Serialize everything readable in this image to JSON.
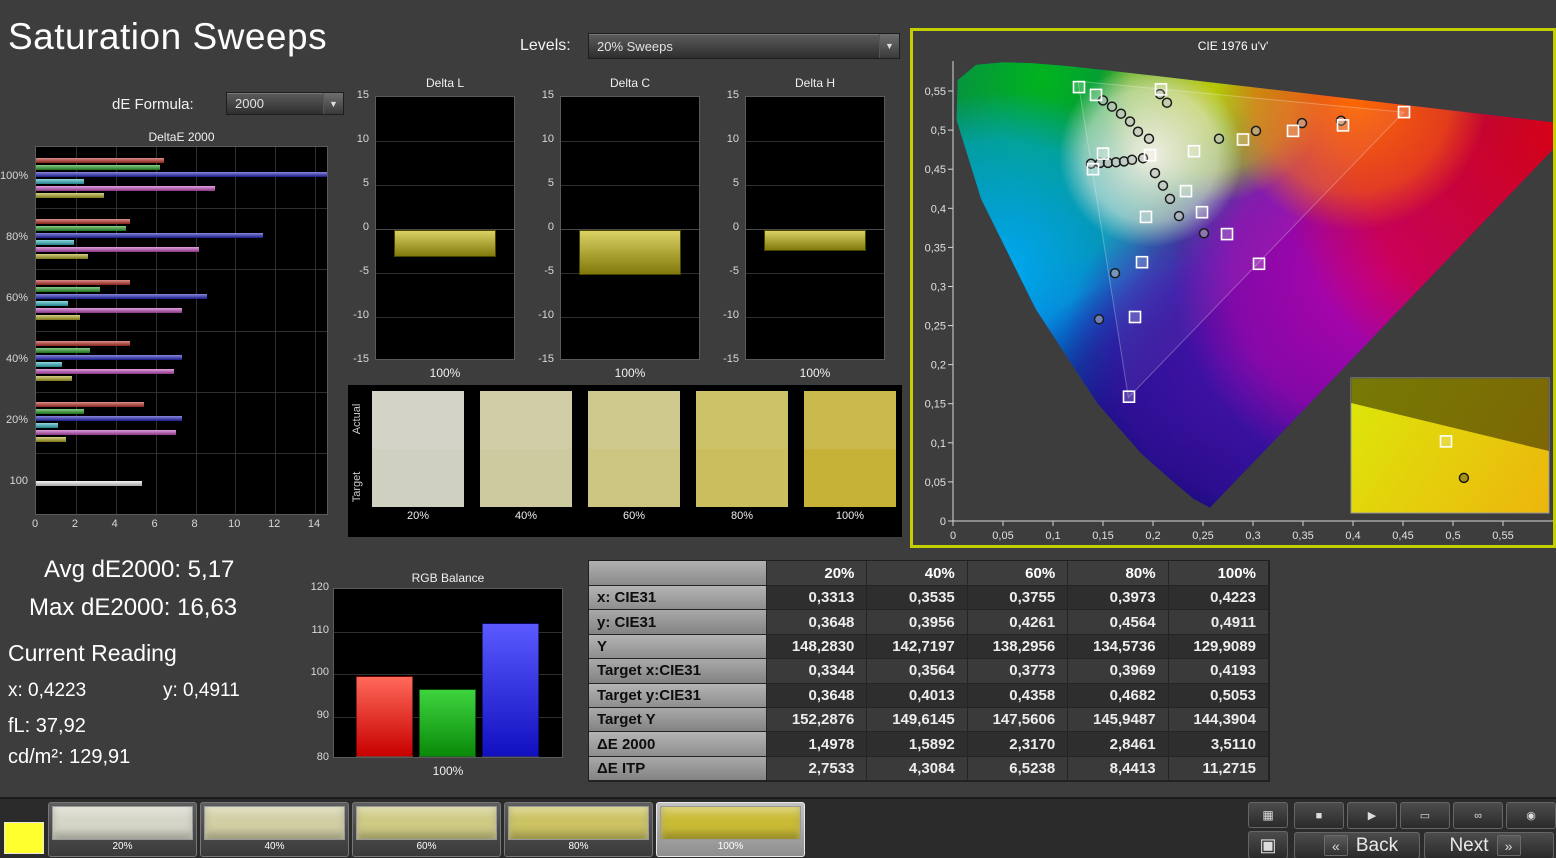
{
  "title": "Saturation Sweeps",
  "controls": {
    "de_formula_label": "dE Formula:",
    "de_formula_value": "2000",
    "levels_label": "Levels:",
    "levels_value": "20% Sweeps"
  },
  "deltae_chart": {
    "title": "DeltaE 2000",
    "x_ticks": [
      0,
      2,
      4,
      6,
      8,
      10,
      12,
      14
    ],
    "x_max": 14.6,
    "bar_colors": [
      "#c03228",
      "#2aa22a",
      "#2626c0",
      "#35b9c5",
      "#c44fc0",
      "#b2aa22",
      "#ececec"
    ],
    "groups": [
      {
        "label": "100%",
        "values": [
          6.4,
          6.2,
          14.6,
          2.4,
          9.0,
          3.4
        ]
      },
      {
        "label": "80%",
        "values": [
          4.7,
          4.5,
          11.4,
          1.9,
          8.2,
          2.6
        ]
      },
      {
        "label": "60%",
        "values": [
          4.7,
          3.2,
          8.6,
          1.6,
          7.3,
          2.2
        ]
      },
      {
        "label": "40%",
        "values": [
          4.7,
          2.7,
          7.3,
          1.3,
          6.9,
          1.8
        ]
      },
      {
        "label": "20%",
        "values": [
          5.4,
          2.4,
          7.3,
          1.1,
          7.0,
          1.5
        ]
      },
      {
        "label": "100",
        "values": [
          5.3
        ]
      }
    ]
  },
  "delta_axis": {
    "min": -15,
    "max": 15,
    "ticks": [
      "15",
      "10",
      "5",
      "0",
      "-5",
      "-10",
      "-15"
    ]
  },
  "delta_charts": [
    {
      "title": "Delta L",
      "value": -3.1,
      "x_label": "100%"
    },
    {
      "title": "Delta C",
      "value": -5.1,
      "x_label": "100%"
    },
    {
      "title": "Delta H",
      "value": -2.4,
      "x_label": "100%"
    }
  ],
  "swatch_strip": {
    "row_labels": [
      "Actual",
      "Target"
    ],
    "columns": [
      {
        "label": "20%",
        "actual": "#d3d3c7",
        "target": "#d0d0c1"
      },
      {
        "label": "40%",
        "actual": "#d1cea7",
        "target": "#cecaa0"
      },
      {
        "label": "60%",
        "actual": "#cec98d",
        "target": "#ccc682"
      },
      {
        "label": "80%",
        "actual": "#ccc268",
        "target": "#cabe5e"
      },
      {
        "label": "100%",
        "actual": "#cab94d",
        "target": "#c6b236"
      }
    ]
  },
  "cie": {
    "title": "CIE 1976 u'v'",
    "tick_step": 0.05,
    "x_tick_labels": [
      "0",
      "0,05",
      "0,1",
      "0,15",
      "0,2",
      "0,25",
      "0,3",
      "0,35",
      "0,4",
      "0,45",
      "0,5",
      "0,55"
    ],
    "y_tick_labels": [
      "0",
      "0,05",
      "0,1",
      "0,15",
      "0,2",
      "0,25",
      "0,3",
      "0,35",
      "0,4",
      "0,45",
      "0,5",
      "0,55"
    ],
    "squares": [
      [
        0.126,
        0.555
      ],
      [
        0.143,
        0.545
      ],
      [
        0.208,
        0.552
      ],
      [
        0.15,
        0.47
      ],
      [
        0.14,
        0.45
      ],
      [
        0.197,
        0.468
      ],
      [
        0.241,
        0.473
      ],
      [
        0.29,
        0.488
      ],
      [
        0.34,
        0.499
      ],
      [
        0.39,
        0.506
      ],
      [
        0.451,
        0.523
      ],
      [
        0.233,
        0.422
      ],
      [
        0.249,
        0.395
      ],
      [
        0.274,
        0.367
      ],
      [
        0.306,
        0.329
      ],
      [
        0.193,
        0.389
      ],
      [
        0.189,
        0.331
      ],
      [
        0.182,
        0.261
      ],
      [
        0.176,
        0.159
      ]
    ],
    "circles": [
      [
        0.15,
        0.538
      ],
      [
        0.159,
        0.53
      ],
      [
        0.168,
        0.521
      ],
      [
        0.177,
        0.511
      ],
      [
        0.185,
        0.498
      ],
      [
        0.207,
        0.546
      ],
      [
        0.214,
        0.535
      ],
      [
        0.138,
        0.457
      ],
      [
        0.147,
        0.458
      ],
      [
        0.155,
        0.458
      ],
      [
        0.163,
        0.459
      ],
      [
        0.171,
        0.46
      ],
      [
        0.179,
        0.462
      ],
      [
        0.19,
        0.464
      ],
      [
        0.196,
        0.489
      ],
      [
        0.266,
        0.489
      ],
      [
        0.303,
        0.499
      ],
      [
        0.349,
        0.509
      ],
      [
        0.388,
        0.512
      ],
      [
        0.202,
        0.445
      ],
      [
        0.21,
        0.429
      ],
      [
        0.217,
        0.412
      ],
      [
        0.226,
        0.39
      ],
      [
        0.251,
        0.368
      ],
      [
        0.162,
        0.317
      ],
      [
        0.146,
        0.258
      ]
    ],
    "inset": {
      "square": [
        0.48,
        0.47
      ],
      "circle": [
        0.57,
        0.74
      ]
    }
  },
  "readings": {
    "avg": "Avg dE2000: 5,17",
    "max": "Max dE2000: 16,63",
    "current_label": "Current Reading",
    "x": "x: 0,4223",
    "y": "y: 0,4911",
    "fl": "fL: 37,92",
    "cdm2": "cd/m²: 129,91"
  },
  "rgb_balance": {
    "title": "RGB Balance",
    "axis": {
      "min": 80,
      "max": 120,
      "ticks": [
        "120",
        "110",
        "100",
        "90",
        "80"
      ]
    },
    "values": {
      "red": 99,
      "green": 96,
      "blue": 111.5
    },
    "x_label": "100%"
  },
  "table": {
    "headers": [
      "",
      "20%",
      "40%",
      "60%",
      "80%",
      "100%"
    ],
    "rows": [
      {
        "label": "x: CIE31",
        "values": [
          "0,3313",
          "0,3535",
          "0,3755",
          "0,3973",
          "0,4223"
        ]
      },
      {
        "label": "y: CIE31",
        "values": [
          "0,3648",
          "0,3956",
          "0,4261",
          "0,4564",
          "0,4911"
        ]
      },
      {
        "label": "Y",
        "values": [
          "148,2830",
          "142,7197",
          "138,2956",
          "134,5736",
          "129,9089"
        ]
      },
      {
        "label": "Target x:CIE31",
        "values": [
          "0,3344",
          "0,3564",
          "0,3773",
          "0,3969",
          "0,4193"
        ]
      },
      {
        "label": "Target y:CIE31",
        "values": [
          "0,3648",
          "0,4013",
          "0,4358",
          "0,4682",
          "0,5053"
        ]
      },
      {
        "label": "Target Y",
        "values": [
          "152,2876",
          "149,6145",
          "147,5606",
          "145,9487",
          "144,3904"
        ]
      },
      {
        "label": "ΔE 2000",
        "values": [
          "1,4978",
          "1,5892",
          "2,3170",
          "2,8461",
          "3,5110"
        ]
      },
      {
        "label": "ΔE ITP",
        "values": [
          "2,7533",
          "4,3084",
          "6,5238",
          "8,4413",
          "11,2715"
        ]
      }
    ]
  },
  "bottom_bar": {
    "current_color": "#ffff2e",
    "swatches": [
      {
        "label": "20%",
        "color": "#d6d6c8"
      },
      {
        "label": "40%",
        "color": "#d2cfa5"
      },
      {
        "label": "60%",
        "color": "#cfcb85"
      },
      {
        "label": "80%",
        "color": "#ccc363"
      },
      {
        "label": "100%",
        "color": "#cabb35"
      }
    ],
    "selected_index": 4,
    "transport_stack": [
      {
        "name": "pattern-grid-button",
        "glyph": "▦"
      },
      {
        "name": "pattern-window-button",
        "glyph": "▣"
      }
    ],
    "transport_buttons": [
      {
        "name": "stop-button",
        "glyph": "■"
      },
      {
        "name": "play-button",
        "glyph": "▶"
      },
      {
        "name": "frame-button",
        "glyph": "▭"
      },
      {
        "name": "continuous-button",
        "glyph": "∞"
      },
      {
        "name": "record-button",
        "glyph": "◉"
      }
    ],
    "back_chevron": "«",
    "next_chevron": "»",
    "back_label": "Back",
    "next_label": "Next"
  }
}
